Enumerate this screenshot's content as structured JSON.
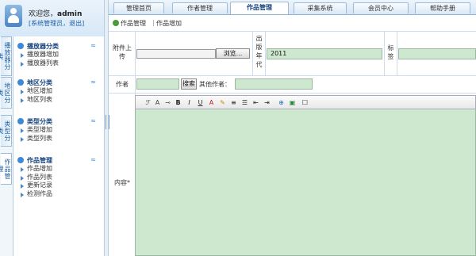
{
  "user": {
    "welcome": "欢迎您，",
    "name": "admin",
    "links": "[系统管理员，退出]"
  },
  "vtabs": [
    "播放器分类",
    "地区分类",
    "类型分类",
    "作品管理"
  ],
  "menu": [
    {
      "title": "播放器分类",
      "items": [
        "播放器增加",
        "播放器列表"
      ]
    },
    {
      "title": "地区分类",
      "items": [
        "地区增加",
        "地区列表"
      ]
    },
    {
      "title": "类型分类",
      "items": [
        "类型增加",
        "类型列表"
      ]
    },
    {
      "title": "作品管理",
      "items": [
        "作品增加",
        "作品列表",
        "更新记录",
        "检测作品"
      ]
    }
  ],
  "tabs": [
    "管理首页",
    "作者管理",
    "作品管理",
    "采集系统",
    "会员中心",
    "帮助手册"
  ],
  "active_tab": "作品管理",
  "breadcrumb": {
    "section": "作品管理",
    "page": "作品增加"
  },
  "form": {
    "attach_label": "附件上传",
    "upload_button": "浏览...",
    "year_label": "出版年代",
    "year_value": "2011",
    "tags_label": "标签",
    "author_label": "作者",
    "search_button": "搜索",
    "other_author_label": "其他作者：",
    "content_label": "内容*"
  },
  "colors": {
    "field_bg": "#cde8cf",
    "accent": "#3b8ad6"
  }
}
